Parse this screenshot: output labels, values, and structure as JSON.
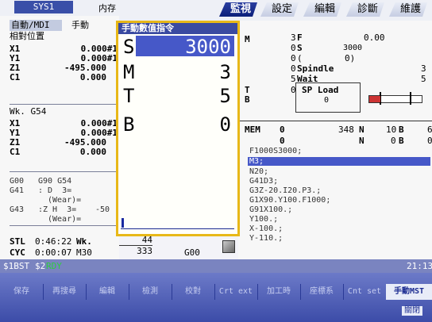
{
  "top": {
    "system": "SYS1",
    "buffer_label": "内存",
    "tabs": [
      "監視",
      "設定",
      "編輯",
      "診斷",
      "維護"
    ]
  },
  "left": {
    "mode_tab": "自動/MDI",
    "mode_tab2": "手動",
    "relative_title": "相對位置",
    "relative": [
      {
        "axis": "X1",
        "value": "0.000#1"
      },
      {
        "axis": "Y1",
        "value": "0.000#1"
      },
      {
        "axis": "Z1",
        "value": "-495.000"
      },
      {
        "axis": "C1",
        "value": "0.000"
      }
    ],
    "work_title": "Wk. G54",
    "work": [
      {
        "axis": "X1",
        "value": "0.000#1"
      },
      {
        "axis": "Y1",
        "value": "0.000#1"
      },
      {
        "axis": "Z1",
        "value": "-495.000"
      },
      {
        "axis": "C1",
        "value": "0.000"
      }
    ],
    "modal": {
      "line1a": "G00",
      "line1b": "G90 G54",
      "line2a": "G41",
      "line2b": ": D  3=",
      "line3": "(Wear)=",
      "line4a": "G43",
      "line4b": ":Z H  3=",
      "line4c": "-50",
      "line5": "(Wear)="
    },
    "stl": {
      "label": "STL",
      "time": "0:46:22",
      "wk_label": "Wk.",
      "wk_value": "44"
    },
    "cyc": {
      "label": "CYC",
      "time": "0:00:07",
      "m_label": "M30",
      "m_value": "333",
      "g_value": "G00"
    }
  },
  "dialog": {
    "title": "手動數值指令",
    "rows": [
      {
        "label": "S",
        "value": "3000"
      },
      {
        "label": "M",
        "value": "3"
      },
      {
        "label": "T",
        "value": "5"
      },
      {
        "label": "B",
        "value": "0"
      }
    ]
  },
  "right": {
    "m_label": "M",
    "t_label": "T",
    "b_label": "B",
    "f_label": "F",
    "f_num": "3",
    "f_value": "0.00",
    "s_label": "S",
    "s_num": "0",
    "s_value": "3000",
    "paren_num": "0",
    "paren_left": "(",
    "paren_right": "0)",
    "spindle_num": "0",
    "spindle_label": "Spindle",
    "spindle_value": "3",
    "wait_num": "5",
    "wait_label": "Wait",
    "wait_value": "5",
    "load_num": "0",
    "load_label": "SP Load",
    "load_zero": "0",
    "mem": "MEM",
    "prog_o1": "0",
    "prog_val": "348",
    "prog_n": "N",
    "prog_nval": "10",
    "prog_b": "B",
    "prog_bval": "6",
    "prog_o2": "0",
    "prog_n2": "N",
    "prog_nval2": "0",
    "prog_b2": "B",
    "prog_bval2": "0",
    "program": [
      "F1000S3000;",
      "M3;",
      "N20;",
      "G41D3;",
      "G3Z-20.I20.P3.;",
      "G1X90.Y100.F1000;",
      "G91X100.;",
      "Y100.;",
      "X-100.;",
      "Y-110.;"
    ],
    "highlight_line": "M3;"
  },
  "status": {
    "bst": "$1BST",
    "rdy_label": "$2",
    "rdy": "RDY",
    "time": "21:13"
  },
  "softkeys": [
    "保存",
    "再搜尋",
    "編輯",
    "檢測",
    "校對",
    "Crt ext",
    "加工時",
    "座標系",
    "Cnt set",
    "手動MST"
  ],
  "softkey_sub": "關閉",
  "colors": {
    "accent": "#1a2a90",
    "dialog_border": "#e8b818",
    "rdy": "#2ecc40",
    "status_bar": "#7a84c0"
  }
}
